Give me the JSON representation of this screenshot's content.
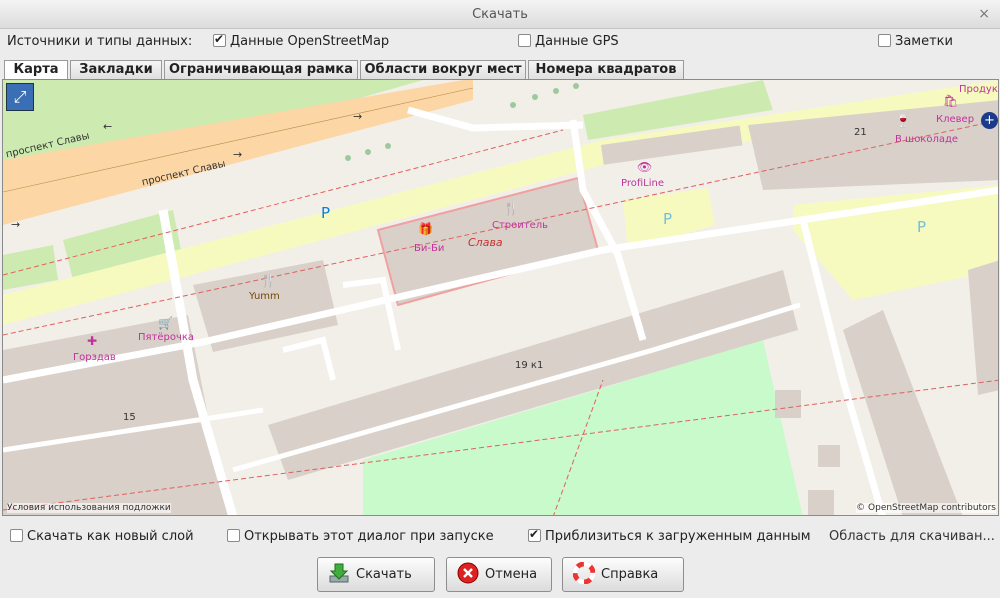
{
  "window": {
    "title": "Скачать",
    "close_glyph": "×"
  },
  "sources": {
    "label": "Источники и типы данных:",
    "osm": {
      "label": "Данные OpenStreetMap",
      "checked": true
    },
    "gps": {
      "label": "Данные GPS",
      "checked": false
    },
    "notes": {
      "label": "Заметки",
      "checked": false
    }
  },
  "tabs": [
    {
      "label": "Карта",
      "active": true
    },
    {
      "label": "Закладки",
      "active": false
    },
    {
      "label": "Ограничивающая рамка",
      "active": false
    },
    {
      "label": "Области вокруг мест",
      "active": false
    },
    {
      "label": "Номера квадратов",
      "active": false
    }
  ],
  "map": {
    "streets": [
      "проспект Славы",
      "проспект Славы"
    ],
    "parking": "P",
    "house_numbers": [
      "21",
      "19 к1",
      "15"
    ],
    "pois": {
      "produkty": "Продук",
      "klever": "Клевер",
      "v_shokolade": "В шоколаде",
      "profiline": "ProfiLine",
      "bibi": "Би-Би",
      "stroitel": "Строитель",
      "slava": "Слава",
      "yumm": "Yumm",
      "pyaterochka": "Пятёрочка",
      "gorzdav": "Горздав"
    },
    "attribution_left": "Условия использования подложки",
    "attribution_right": "© OpenStreetMap contributors"
  },
  "options": {
    "new_layer": {
      "label": "Скачать как новый слой",
      "checked": false
    },
    "open_on_start": {
      "label": "Открывать этот диалог при запуске",
      "checked": false
    },
    "zoom_to_data": {
      "label": "Приблизиться к загруженным данным",
      "checked": true
    },
    "area_text": "Область для скачиван..."
  },
  "buttons": {
    "download": "Скачать",
    "cancel": "Отмена",
    "help": "Справка"
  },
  "colors": {
    "road_primary": "#fcd6a4",
    "road_secondary": "#f7fabf",
    "building": "#d9d0c9",
    "park": "#cdebb0",
    "grass": "#c8facc",
    "poi": "#c0339c"
  }
}
